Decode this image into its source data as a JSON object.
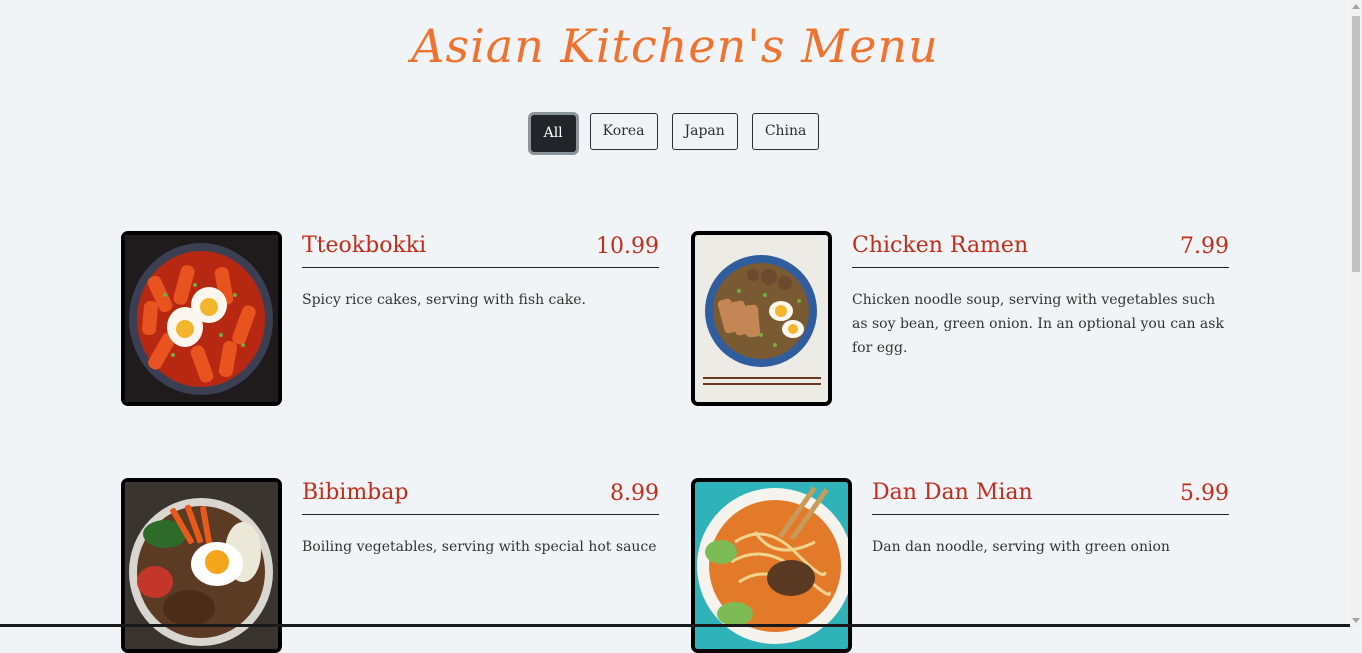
{
  "page": {
    "title": "Asian Kitchen's Menu"
  },
  "filters": [
    "All",
    "Korea",
    "Japan",
    "China"
  ],
  "active_filter": "All",
  "menu": [
    {
      "name": "Tteokbokki",
      "price": "10.99",
      "desc": "Spicy rice cakes, serving with fish cake.",
      "image": "tteokbokki-photo"
    },
    {
      "name": "Chicken Ramen",
      "price": "7.99",
      "desc": "Chicken noodle soup, serving with vegetables such as soy bean, green onion. In an optional you can ask for egg.",
      "image": "chicken-ramen-photo"
    },
    {
      "name": "Bibimbap",
      "price": "8.99",
      "desc": "Boiling vegetables, serving with special hot sauce",
      "image": "bibimbap-photo"
    },
    {
      "name": "Dan Dan Mian",
      "price": "5.99",
      "desc": "Dan dan noodle, serving with green onion",
      "image": "dan-dan-mian-photo"
    }
  ],
  "colors": {
    "title": "#f0722f",
    "item_text": "#c32b1a",
    "background": "#f1f4f7",
    "active_button": "#212529"
  }
}
